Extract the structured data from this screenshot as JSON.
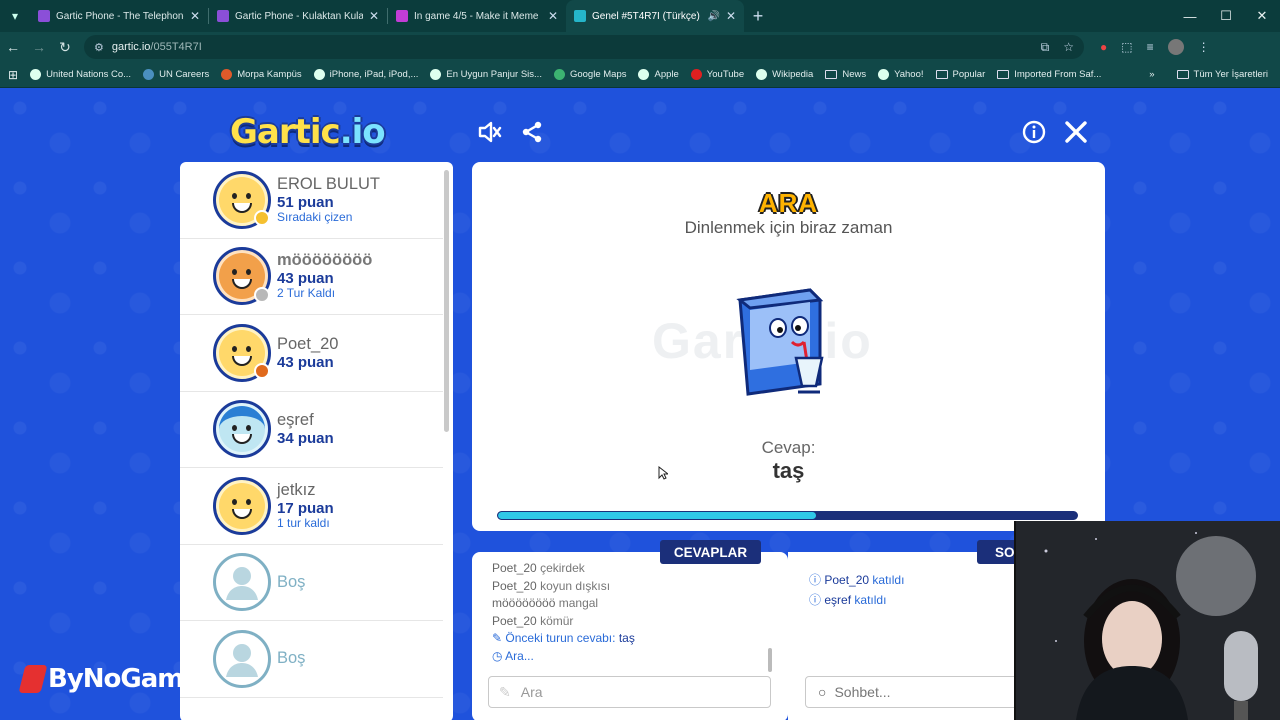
{
  "browser": {
    "tabs": [
      {
        "title": "Gartic Phone - The Telephone G",
        "color": "#8b4fd8",
        "active": false
      },
      {
        "title": "Gartic Phone - Kulaktan Kulağa",
        "color": "#8b4fd8",
        "active": false
      },
      {
        "title": "In game 4/5 - Make it Meme",
        "color": "#c23dd6",
        "active": false
      },
      {
        "title": "Genel #5T4R7I (Türkçe) - Ga",
        "color": "#25b5c9",
        "active": true
      }
    ],
    "url_host": "gartic.io",
    "url_path": "/055T4R7I",
    "bookmarks": [
      {
        "label": "United Nations Co...",
        "type": "globe"
      },
      {
        "label": "UN Careers",
        "type": "globe"
      },
      {
        "label": "Morpa Kampüs",
        "type": "globe"
      },
      {
        "label": "iPhone, iPad, iPod,...",
        "type": "globe"
      },
      {
        "label": "En Uygun Panjur Sis...",
        "type": "globe"
      },
      {
        "label": "Google Maps",
        "type": "globe"
      },
      {
        "label": "Apple",
        "type": "globe"
      },
      {
        "label": "YouTube",
        "type": "globe"
      },
      {
        "label": "Wikipedia",
        "type": "globe"
      },
      {
        "label": "News",
        "type": "folder"
      },
      {
        "label": "Yahoo!",
        "type": "globe"
      },
      {
        "label": "Popular",
        "type": "folder"
      },
      {
        "label": "Imported From Saf...",
        "type": "folder"
      }
    ],
    "all_bookmarks": "Tüm Yer İşaretleri"
  },
  "game": {
    "logo_main": "Gartic",
    "logo_io": ".io",
    "players": [
      {
        "name": "EROL BULUT",
        "points": "51 puan",
        "status": "Sıradaki çizen",
        "skin": "#ffd86a",
        "badge": "#f5c030",
        "hair": null
      },
      {
        "name": "möööööööö",
        "points": "43 puan",
        "status": "2 Tur Kaldı",
        "skin": "#f2a04a",
        "badge": "#b8b8b8",
        "hair": null
      },
      {
        "name": "Poet_20",
        "points": "43 puan",
        "status": "",
        "skin": "#ffd86a",
        "badge": "#e06a1c",
        "hair": null
      },
      {
        "name": "eşref",
        "points": "34 puan",
        "status": "",
        "skin": "#bfe6f2",
        "badge": null,
        "hair": "#2a7fd4"
      },
      {
        "name": "jetkız",
        "points": "17 puan",
        "status": "1 tur kaldı",
        "skin": "#ffd86a",
        "badge": null,
        "hair": null
      }
    ],
    "empty_slots": [
      {
        "name": "Boş"
      },
      {
        "name": "Boş"
      }
    ],
    "state_title": "ARA",
    "state_subtitle": "Dinlenmek için biraz zaman",
    "answer_label": "Cevap:",
    "answer_value": "taş",
    "round_progress": 0.55,
    "answers_tab": "CEVAPLAR",
    "chat_tab": "SO",
    "answers": [
      {
        "name": "Poet_20",
        "text": "çekirdek"
      },
      {
        "name": "Poet_20",
        "text": "koyun dışkısı"
      },
      {
        "name": "möööööööö",
        "text": "mangal"
      },
      {
        "name": "Poet_20",
        "text": "kömür"
      }
    ],
    "prev_answer_label": "Önceki turun cevabı:",
    "prev_answer_value": "taş",
    "break_note": "Ara...",
    "answer_placeholder": "Ara",
    "chat_lines": [
      {
        "who": "Poet_20",
        "text": "katıldı"
      },
      {
        "who": "eşref",
        "text": "katıldı"
      }
    ],
    "chat_placeholder": "Sohbet..."
  },
  "overlay": {
    "brand": "ByNoGame"
  }
}
